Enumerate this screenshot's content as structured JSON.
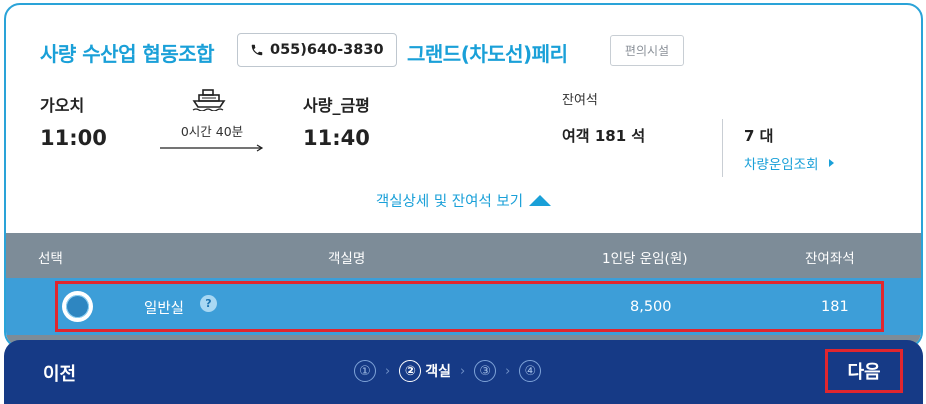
{
  "header": {
    "company": "사량 수산업 협동조합",
    "phone": "055)640-3830",
    "ship_name": "그랜드(차도선)페리",
    "facility_label": "편의시설"
  },
  "schedule": {
    "departure_port": "가오치",
    "departure_time": "11:00",
    "duration": "0시간 40분",
    "arrival_port": "사량_금평",
    "arrival_time": "11:40"
  },
  "seats": {
    "title": "잔여석",
    "passenger": "여객 181 석",
    "vehicle": "7 대",
    "vehicle_link": "차량운임조회"
  },
  "detail_toggle": "객실상세 및 잔여석 보기",
  "table": {
    "headers": [
      "선택",
      "객실명",
      "1인당 운임(원)",
      "잔여좌석"
    ],
    "rows": [
      {
        "room": "일반실",
        "help": "?",
        "fare": "8,500",
        "remaining": "181"
      }
    ]
  },
  "footer": {
    "prev": "이전",
    "steps": [
      "①",
      "②",
      "③",
      "④"
    ],
    "active_step_label": "객실",
    "next": "다음"
  },
  "colors": {
    "accent": "#1aa0d8",
    "navy": "#163a86",
    "highlight": "#e0262e"
  }
}
